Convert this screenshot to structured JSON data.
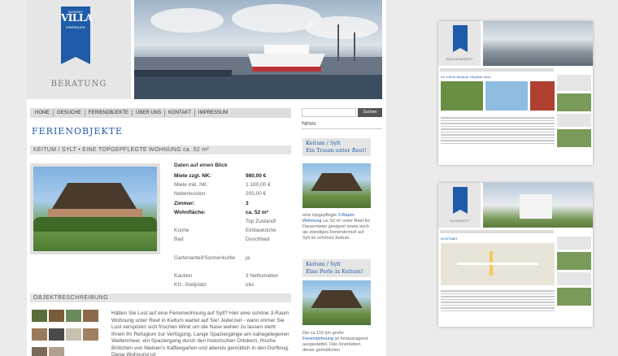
{
  "logo": {
    "text": "VILLA",
    "subtext": "SCHMIDT",
    "sub2": "IMMOBILIEN",
    "section": "BERATUNG"
  },
  "nav": [
    "HOME",
    "GESUCHE",
    "FERIENOBJEKTE",
    "ÜBER UNS",
    "KONTAKT",
    "IMPRESSUM"
  ],
  "search": {
    "button": "Suchen"
  },
  "page_title": "FERIENOBJEKTE",
  "listing": {
    "heading": "KEITUM / SYLT • EINE TOPGEPFLEGTE WOHNUNG ca. 52 m²",
    "facts_title": "Daten auf einen Blick",
    "facts": [
      {
        "k": "Miete zzgl. NK:",
        "v": "980,00 €",
        "bold": true
      },
      {
        "k": "Miete inkl. NK:",
        "v": "1.180,00 €",
        "bold": false
      },
      {
        "k": "Nebenkosten:",
        "v": "200,00 €",
        "bold": false
      },
      {
        "k": "Zimmer:",
        "v": "3",
        "bold": true
      },
      {
        "k": "Wohnfläche:",
        "v": "ca. 52 m²",
        "bold": true
      },
      {
        "k": "",
        "v": "Top Zustand!",
        "bold": false
      },
      {
        "k": "Küche",
        "v": "Einbauküche",
        "bold": false
      },
      {
        "k": "Bad",
        "v": "Duschbad",
        "bold": false
      },
      {
        "k": "",
        "v": "",
        "bold": false
      },
      {
        "k": "Gartenanteil/Sonnenkuhle",
        "v": "ja",
        "bold": false
      },
      {
        "k": "",
        "v": "",
        "bold": false
      },
      {
        "k": "Kaution",
        "v": "3 Nettomieten",
        "bold": false
      },
      {
        "k": "Kfz.-Stellplatz",
        "v": "inkl.",
        "bold": false
      }
    ],
    "desc_heading": "OBJEKTBESCHREIBUNG",
    "description": "Hätten Sie Lust auf eine Ferienwohnung auf Sylt? Hier eine schöne 3-Raum Wohnung unter Reet in Keitum wartet auf Sie! Jederzeit - wann immer Sie Lust verspüren sich frischen Wind um die Nase wehen zu lassen steht Ihnen Ihr Refugium zur Verfügung. Lange Spaziergänge am nahegelegenen Wattenmeer, ein Spaziergang durch den historischen Ortskern, frische Brötchen von Nielsen's Kaffeegarten und abends gemütlich in den Dorfkrug. Diese Wohnung ist"
  },
  "news": {
    "title": "News",
    "items": [
      {
        "heading1": "Keitum / Sylt",
        "heading2": "Ein Traum unter Reet!",
        "text_pre": "eine topgepflegte ",
        "link": "3-Raum-Wohnung",
        "text_post": " ca. 52 m² unter Reet für Dauermieter geeignet sowie auch als ständiges Feriendomizil auf Sylt im schönen Keitum."
      },
      {
        "heading1": "Keitum / Sylt",
        "heading2": "Eine Perle in Keitum!",
        "text_pre": "Die ca.110 qm große ",
        "link": "Ferienwohnung",
        "text_post": " ist herausragend ausgestattet. Das Innenleben dieser gemütlichen"
      }
    ]
  },
  "mini1": {
    "section": "EINLAGEMENT",
    "title": "So schön können Objekte sein"
  },
  "mini2": {
    "section": "KONTAKT",
    "label": "SCHMIDTZ",
    "title": "KONTAKT"
  },
  "colors": {
    "accent": "#1f5ba8",
    "grey_bar": "#e5e5e5"
  }
}
